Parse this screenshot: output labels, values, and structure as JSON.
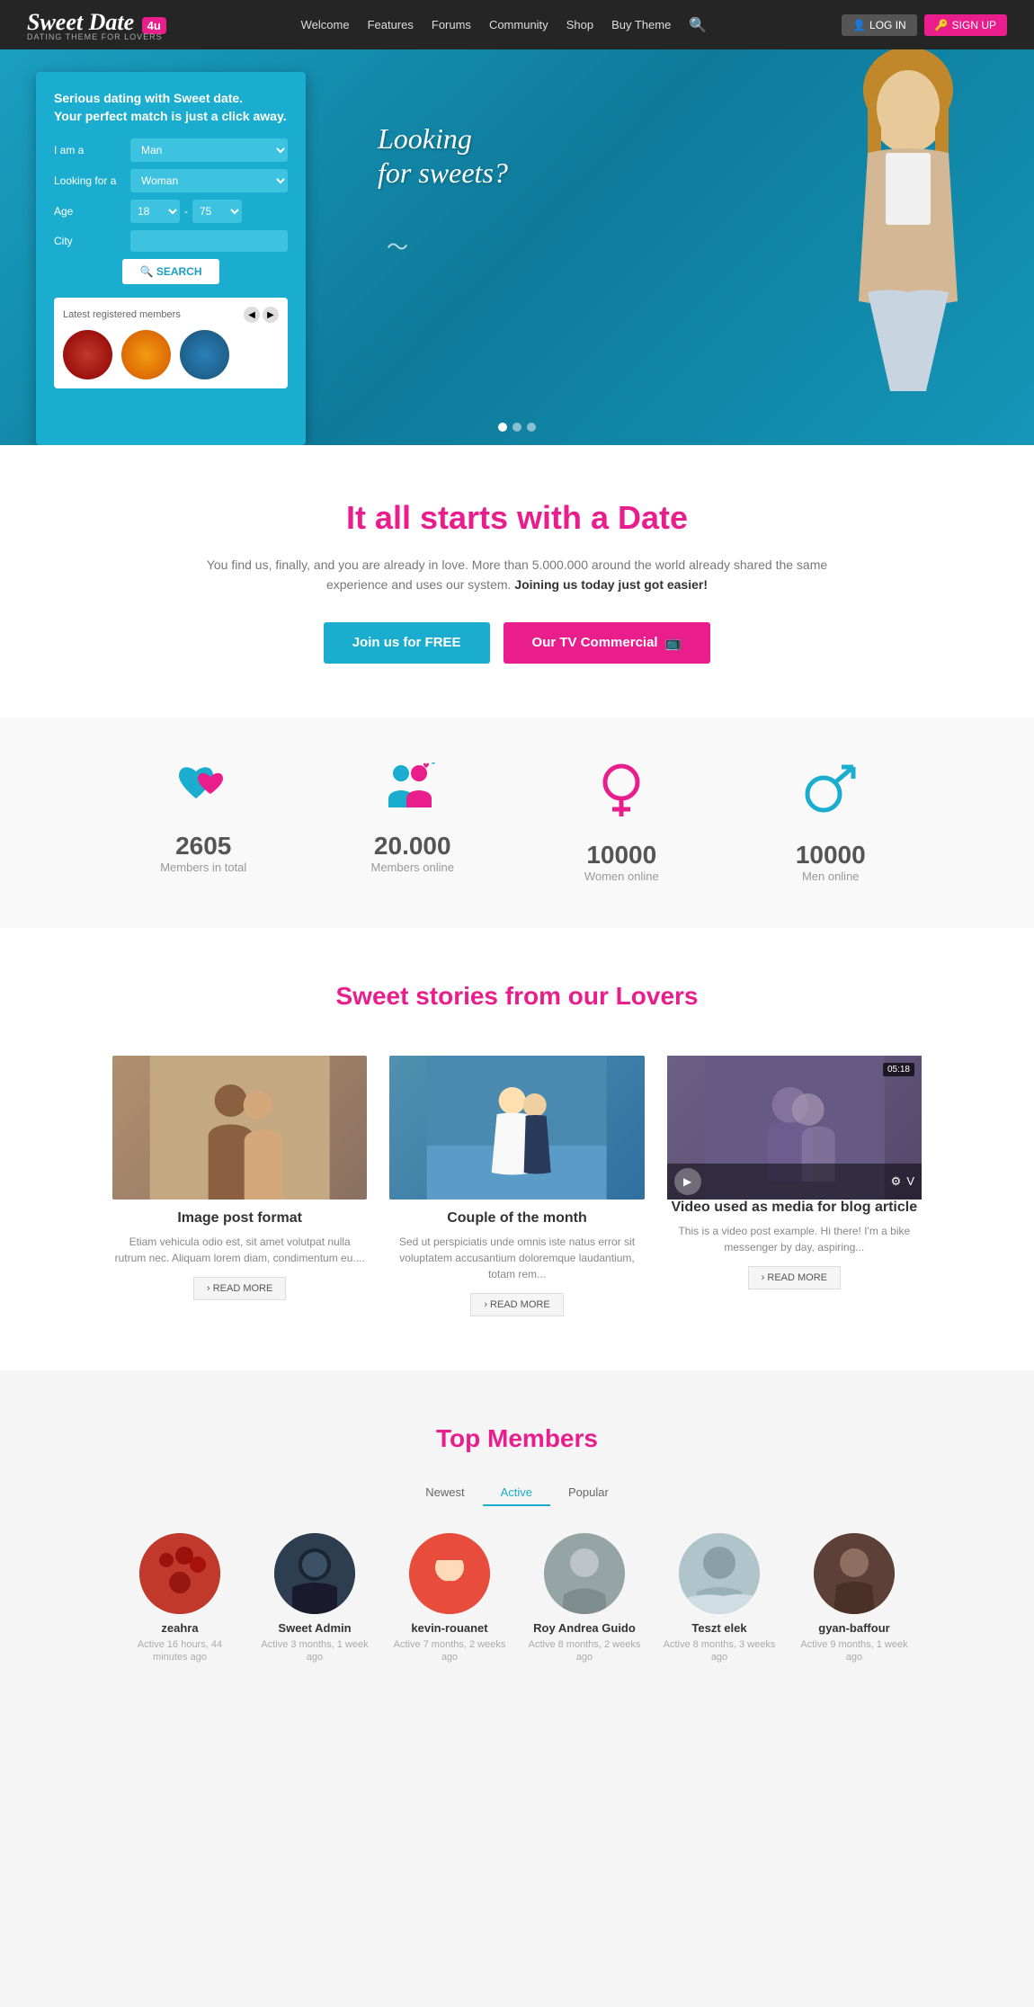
{
  "navbar": {
    "logo": "Sweet Date",
    "logo_script": "4u",
    "logo_sub": "DATING THEME FOR LOVERS",
    "nav_links": [
      {
        "label": "Welcome",
        "href": "#"
      },
      {
        "label": "Features",
        "href": "#"
      },
      {
        "label": "Forums",
        "href": "#"
      },
      {
        "label": "Community",
        "href": "#"
      },
      {
        "label": "Shop",
        "href": "#"
      },
      {
        "label": "Buy Theme",
        "href": "#"
      }
    ],
    "login_label": "LOG IN",
    "signup_label": "SIGN UP"
  },
  "hero": {
    "form": {
      "title_normal": "Serious dating with ",
      "title_bold": "Sweet date.",
      "subtitle": "Your perfect match is just a click away.",
      "iam_label": "I am a",
      "lookingfor_label": "Looking for a",
      "age_label": "Age",
      "age_min": "18",
      "age_max": "75",
      "city_label": "City",
      "city_placeholder": "",
      "search_label": "SEARCH"
    },
    "latest_members": {
      "title": "Latest registered members"
    },
    "tagline": "Looking\nfor sweets?",
    "dots": [
      true,
      false,
      false
    ]
  },
  "date_section": {
    "heading_normal": "It all starts with a ",
    "heading_highlight": "Date",
    "description": "You find us, finally, and you are already in love. More than 5.000.000 around the world already shared the same experience and uses our system. ",
    "description_bold": "Joining us today just got easier!",
    "btn_join": "Join us for FREE",
    "btn_tv": "Our TV Commercial"
  },
  "stats": [
    {
      "icon": "hearts-icon",
      "number": "2605",
      "label": "Members in total"
    },
    {
      "icon": "couple-icon",
      "number": "20.000",
      "label": "Members online"
    },
    {
      "icon": "female-icon",
      "number": "10000",
      "label": "Women online"
    },
    {
      "icon": "male-icon",
      "number": "10000",
      "label": "Men online"
    }
  ],
  "stories": {
    "heading_normal": "Sweet stories from ",
    "heading_highlight": "our Lovers",
    "items": [
      {
        "type": "image",
        "title": "Image post format",
        "description": "Etiam vehicula odio est, sit amet volutpat nulla rutrum nec. Aliquam lorem diam, condimentum eu....",
        "read_more": "› READ MORE"
      },
      {
        "type": "image",
        "title": "Couple of the month",
        "description": "Sed ut perspiciatis unde omnis iste natus error sit voluptatem accusantium doloremque laudantium, totam rem...",
        "read_more": "› READ MORE"
      },
      {
        "type": "video",
        "title": "Video used as media for blog article",
        "description": "This is a video post example. Hi there! I'm a bike messenger by day, aspiring...",
        "video_time": "05:18",
        "read_more": "› READ MORE"
      }
    ]
  },
  "top_members": {
    "heading_normal": "Top ",
    "heading_highlight": "Members",
    "tabs": [
      "Newest",
      "Active",
      "Popular"
    ],
    "active_tab": "Active",
    "members": [
      {
        "name": "zeahra",
        "active_text": "Active 16 hours, 44\nminutes ago",
        "avatar_class": "ma-1"
      },
      {
        "name": "Sweet Admin",
        "active_text": "Active 3 months, 1 week\nago",
        "avatar_class": "ma-2"
      },
      {
        "name": "kevin-rouanet",
        "active_text": "Active 7 months, 2 weeks\nago",
        "avatar_class": "ma-3"
      },
      {
        "name": "Roy Andrea Guido",
        "active_text": "Active 8 months, 2 weeks\nago",
        "avatar_class": "ma-4"
      },
      {
        "name": "Teszt elek",
        "active_text": "Active 8 months, 3 weeks\nago",
        "avatar_class": "ma-4"
      },
      {
        "name": "gyan-baffour",
        "active_text": "Active 9 months, 1 week\nago",
        "avatar_class": "ma-5"
      }
    ]
  }
}
